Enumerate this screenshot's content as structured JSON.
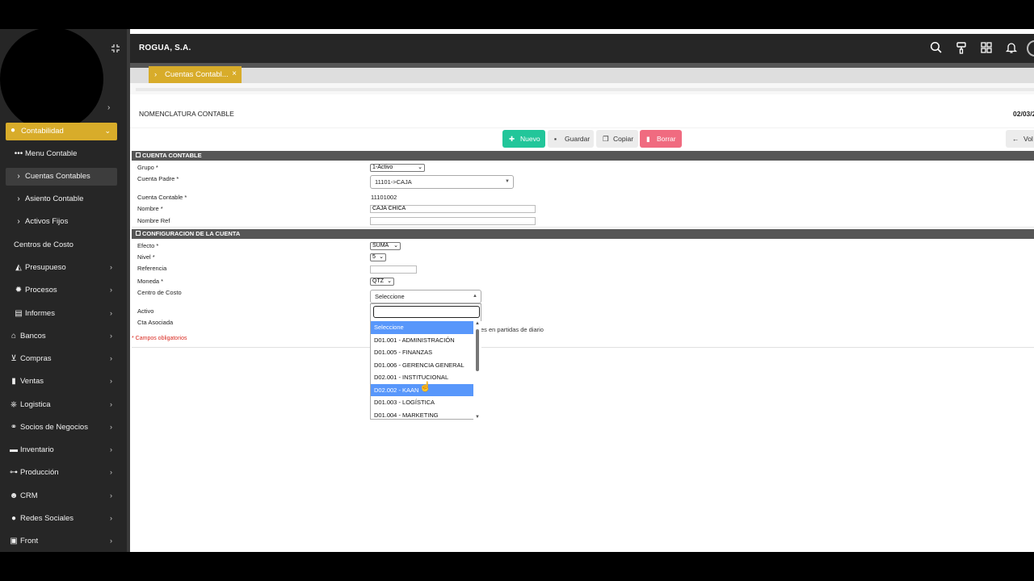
{
  "topbar": {
    "company": "ROGUA, S.A."
  },
  "sidebar": {
    "active_section": "Contabilidad",
    "items": [
      {
        "label": "Menu Contable",
        "icon": "dots-icon"
      },
      {
        "label": "Cuentas Contables",
        "icon": "chevron-right-icon"
      },
      {
        "label": "Asiento Contable",
        "icon": "chevron-right-icon"
      },
      {
        "label": "Activos Fijos",
        "icon": "chevron-right-icon"
      },
      {
        "label": "Centros de Costo",
        "icon": ""
      },
      {
        "label": "Presupueso",
        "icon": "gauge-icon"
      },
      {
        "label": "Procesos",
        "icon": "gear-icon"
      },
      {
        "label": "Informes",
        "icon": "printer-icon"
      },
      {
        "label": "Bancos",
        "icon": "bank-icon"
      },
      {
        "label": "Compras",
        "icon": "cart-icon"
      },
      {
        "label": "Ventas",
        "icon": "document-icon"
      },
      {
        "label": "Logistica",
        "icon": "logistics-icon"
      },
      {
        "label": "Socios de Negocios",
        "icon": "partners-icon"
      },
      {
        "label": "Inventario",
        "icon": "truck-icon"
      },
      {
        "label": "Producción",
        "icon": "sitemap-icon"
      },
      {
        "label": "CRM",
        "icon": "users-icon"
      },
      {
        "label": "Redes Sociales",
        "icon": "globe-icon"
      },
      {
        "label": "Front",
        "icon": "window-icon"
      }
    ]
  },
  "tabs": [
    {
      "label": "Cuentas Contabl...",
      "close": "×"
    }
  ],
  "page": {
    "title": "NOMENCLATURA CONTABLE",
    "date": "02/03/2"
  },
  "toolbar": {
    "nuevo": "Nuevo",
    "guardar": "Guardar",
    "copiar": "Copiar",
    "borrar": "Borrar",
    "volver": "Vol"
  },
  "section_cuenta": {
    "title": "CUENTA CONTABLE",
    "grupo_label": "Grupo *",
    "grupo_value": "1-Activo",
    "cuenta_padre_label": "Cuenta Padre *",
    "cuenta_padre_value": "11101->CAJA",
    "cuenta_contable_label": "Cuenta Contable *",
    "cuenta_contable_value": "11101002",
    "nombre_label": "Nombre *",
    "nombre_value": "CAJA CHICA",
    "nombre_ref_label": "Nombre Ref",
    "nombre_ref_value": ""
  },
  "section_config": {
    "title": "CONFIGURACION DE LA CUENTA",
    "efecto_label": "Efecto *",
    "efecto_value": "SUMA",
    "nivel_label": "Nivel *",
    "nivel_value": "5",
    "referencia_label": "Referencia",
    "referencia_value": "",
    "moneda_label": "Moneda *",
    "moneda_value": "QTZ",
    "centro_costo_label": "Centro de Costo",
    "centro_costo_value": "Seleccione",
    "activo_label": "Activo",
    "cta_asociada_label": "Cta Asociada",
    "diario_text": "es en partidas de diario"
  },
  "required_note": "* Campos obligatorios",
  "dropdown": {
    "search_value": "",
    "options": [
      "Seleccione",
      "D01.001 - ADMINISTRACIÓN",
      "D01.005 - FINANZAS",
      "D01.006 - GERENCIA GENERAL",
      "D02.001 - INSTITUCIONAL",
      "D02.002 - KAAN",
      "D01.003 - LOGÍSTICA",
      "D01.004 - MARKETING"
    ],
    "selected": "Seleccione",
    "hovered": "D02.002 - KAAN"
  },
  "colors": {
    "sidebar_bg": "#262626",
    "accent_gold": "#d8ac2a",
    "nuevo_green": "#22c69a",
    "borrar_red": "#f06b80",
    "option_highlight": "#5897fb"
  }
}
